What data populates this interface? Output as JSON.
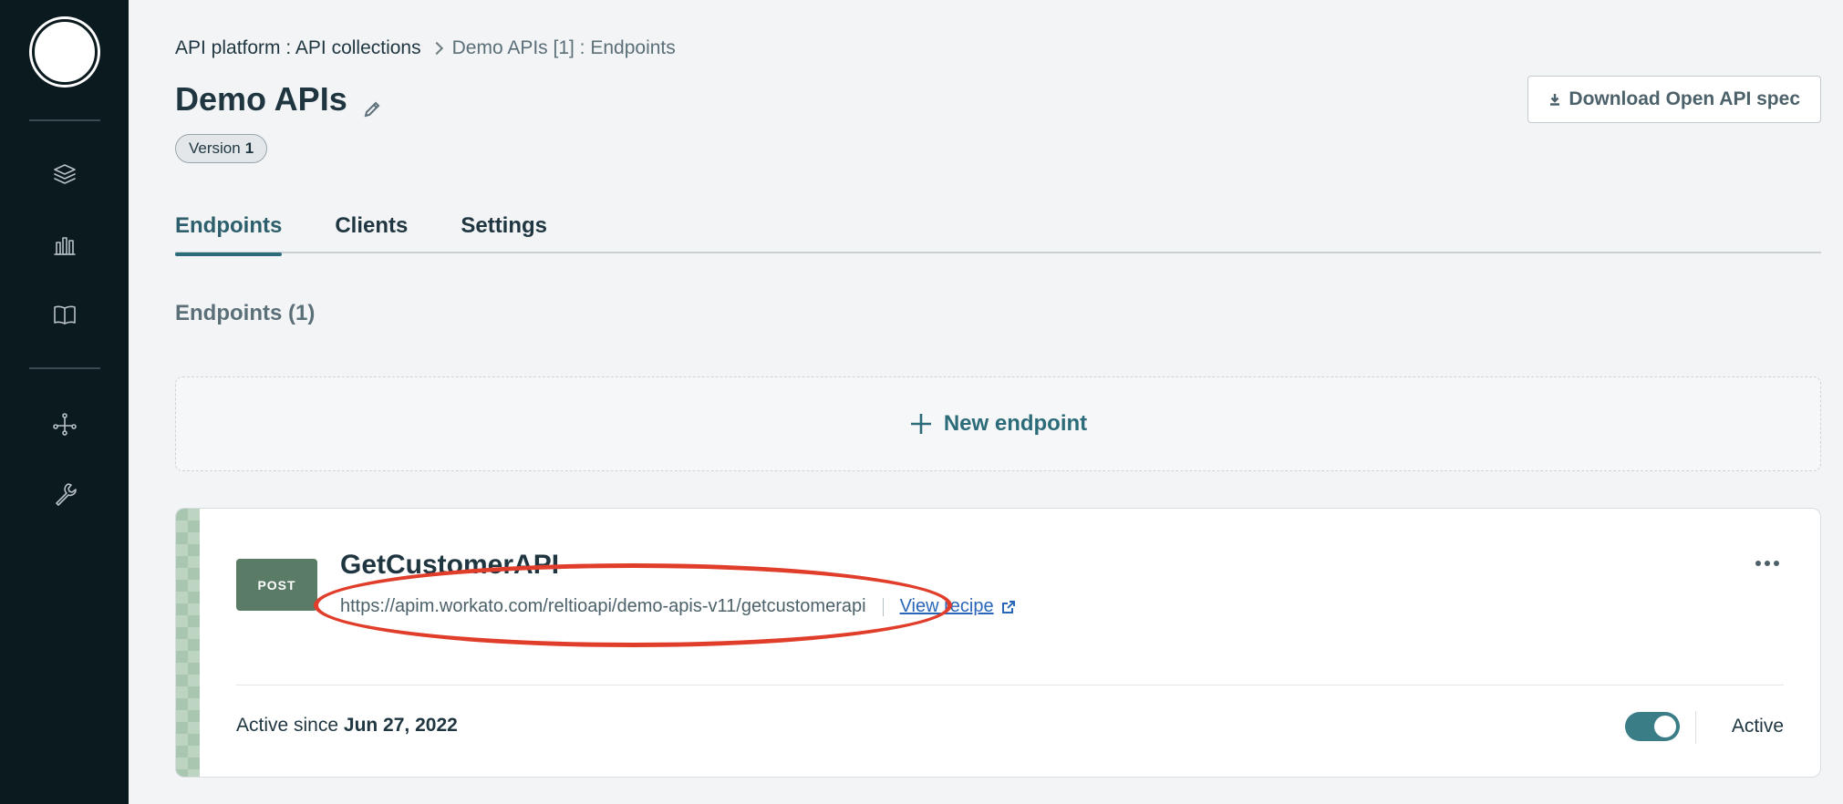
{
  "sidebar": {
    "items": [
      {
        "icon": "layers-icon"
      },
      {
        "icon": "bar-chart-icon"
      },
      {
        "icon": "book-icon"
      },
      {
        "icon": "network-icon"
      },
      {
        "icon": "wrench-icon"
      }
    ]
  },
  "breadcrumb": {
    "root": "API platform : API collections",
    "current": "Demo APIs [1] : Endpoints"
  },
  "header": {
    "title": "Demo APIs",
    "version_label": "Version",
    "version_number": "1",
    "download_label": "Download Open API spec"
  },
  "tabs": [
    {
      "label": "Endpoints",
      "active": true
    },
    {
      "label": "Clients",
      "active": false
    },
    {
      "label": "Settings",
      "active": false
    }
  ],
  "endpoints": {
    "section_title": "Endpoints (1)",
    "new_label": "New endpoint",
    "items": [
      {
        "method": "POST",
        "name": "GetCustomerAPI",
        "url": "https://apim.workato.com/reltioapi/demo-apis-v11/getcustomerapi",
        "view_recipe": "View recipe",
        "active_since_label": "Active since",
        "active_since_date": "Jun 27, 2022",
        "status": "Active"
      }
    ]
  },
  "colors": {
    "sidebar_bg": "#0b1a1f",
    "accent": "#2c6b79",
    "post_badge": "#5a7b65",
    "annotation": "#e03d2a",
    "link": "#2a66b8"
  }
}
